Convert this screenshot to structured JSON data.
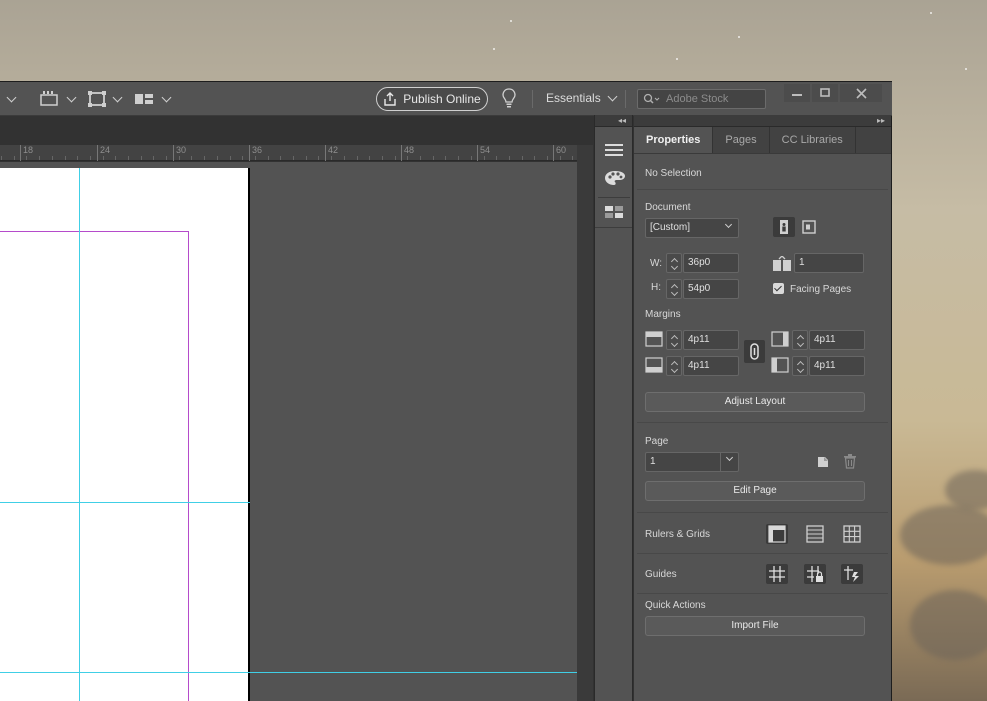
{
  "topbar": {
    "publish_label": "Publish Online",
    "workspace_label": "Essentials",
    "stock_placeholder": "Adobe Stock"
  },
  "ruler": {
    "ticks": [
      "18",
      "24",
      "30",
      "36",
      "42",
      "48",
      "54",
      "60"
    ]
  },
  "panel": {
    "tabs": [
      {
        "label": "Properties",
        "active": true
      },
      {
        "label": "Pages",
        "active": false
      },
      {
        "label": "CC Libraries",
        "active": false
      }
    ],
    "selection_status": "No Selection",
    "document": {
      "heading": "Document",
      "preset": "[Custom]",
      "width_label": "W:",
      "width": "36p0",
      "height_label": "H:",
      "height": "54p0",
      "pages_count": "1",
      "facing_pages_label": "Facing Pages",
      "facing_pages_checked": true
    },
    "margins": {
      "heading": "Margins",
      "top": "4p11",
      "bottom": "4p11",
      "inside": "4p11",
      "outside": "4p11"
    },
    "adjust_layout_label": "Adjust Layout",
    "page": {
      "heading": "Page",
      "current": "1",
      "edit_page_label": "Edit Page"
    },
    "rulers_grids_label": "Rulers & Grids",
    "guides_label": "Guides",
    "quick_actions": {
      "heading": "Quick Actions",
      "import_file_label": "Import File"
    }
  },
  "colors": {
    "guide": "#40cfe6",
    "margin": "#b54bcb",
    "panel_bg": "#535353"
  }
}
